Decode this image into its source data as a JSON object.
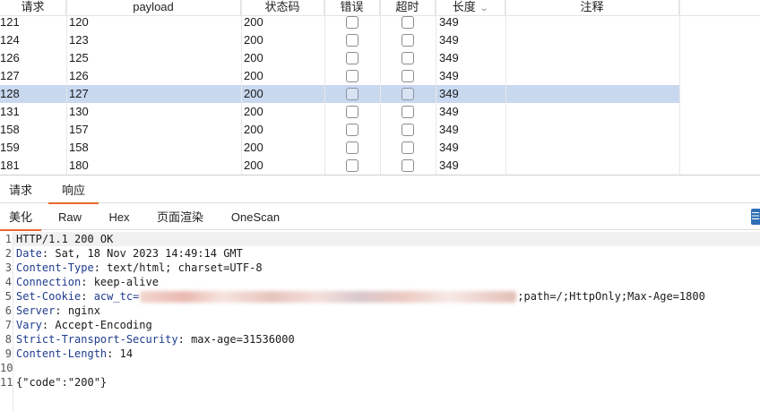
{
  "table": {
    "columns": [
      {
        "key": "request",
        "label": "请求"
      },
      {
        "key": "payload",
        "label": "payload"
      },
      {
        "key": "status",
        "label": "状态码"
      },
      {
        "key": "error",
        "label": "错误"
      },
      {
        "key": "timeout",
        "label": "超时"
      },
      {
        "key": "length",
        "label": "长度",
        "sort": "desc"
      },
      {
        "key": "comment",
        "label": "注释"
      }
    ],
    "rows": [
      {
        "request": "121",
        "payload": "120",
        "status": "200",
        "error": false,
        "timeout": false,
        "length": "349",
        "comment": "",
        "selected": false
      },
      {
        "request": "124",
        "payload": "123",
        "status": "200",
        "error": false,
        "timeout": false,
        "length": "349",
        "comment": "",
        "selected": false
      },
      {
        "request": "126",
        "payload": "125",
        "status": "200",
        "error": false,
        "timeout": false,
        "length": "349",
        "comment": "",
        "selected": false
      },
      {
        "request": "127",
        "payload": "126",
        "status": "200",
        "error": false,
        "timeout": false,
        "length": "349",
        "comment": "",
        "selected": false
      },
      {
        "request": "128",
        "payload": "127",
        "status": "200",
        "error": false,
        "timeout": false,
        "length": "349",
        "comment": "",
        "selected": true
      },
      {
        "request": "131",
        "payload": "130",
        "status": "200",
        "error": false,
        "timeout": false,
        "length": "349",
        "comment": "",
        "selected": false
      },
      {
        "request": "158",
        "payload": "157",
        "status": "200",
        "error": false,
        "timeout": false,
        "length": "349",
        "comment": "",
        "selected": false
      },
      {
        "request": "159",
        "payload": "158",
        "status": "200",
        "error": false,
        "timeout": false,
        "length": "349",
        "comment": "",
        "selected": false
      },
      {
        "request": "181",
        "payload": "180",
        "status": "200",
        "error": false,
        "timeout": false,
        "length": "349",
        "comment": "",
        "selected": false
      }
    ]
  },
  "tabs": {
    "request_label": "请求",
    "response_label": "响应",
    "active": "response"
  },
  "view_tabs": {
    "items": [
      "美化",
      "Raw",
      "Hex",
      "页面渲染",
      "OneScan"
    ],
    "active": 0
  },
  "response": {
    "status_line": "HTTP/1.1 200 OK",
    "headers": [
      {
        "name": "Date",
        "value": "Sat, 18 Nov 2023 14:49:14 GMT"
      },
      {
        "name": "Content-Type",
        "value": "text/html; charset=UTF-8"
      },
      {
        "name": "Connection",
        "value": "keep-alive"
      },
      {
        "name": "Set-Cookie",
        "value_prefix": "acw_tc=",
        "value_suffix": ";path=/;HttpOnly;Max-Age=1800",
        "redacted": true
      },
      {
        "name": "Server",
        "value": "nginx"
      },
      {
        "name": "Vary",
        "value": "Accept-Encoding"
      },
      {
        "name": "Strict-Transport-Security",
        "value": "max-age=31536000"
      },
      {
        "name": "Content-Length",
        "value": "14"
      }
    ],
    "body": "{\"code\":\"200\"}"
  },
  "icons": {
    "sort": "chevron-down-icon",
    "side": "panel-toggle-icon"
  }
}
